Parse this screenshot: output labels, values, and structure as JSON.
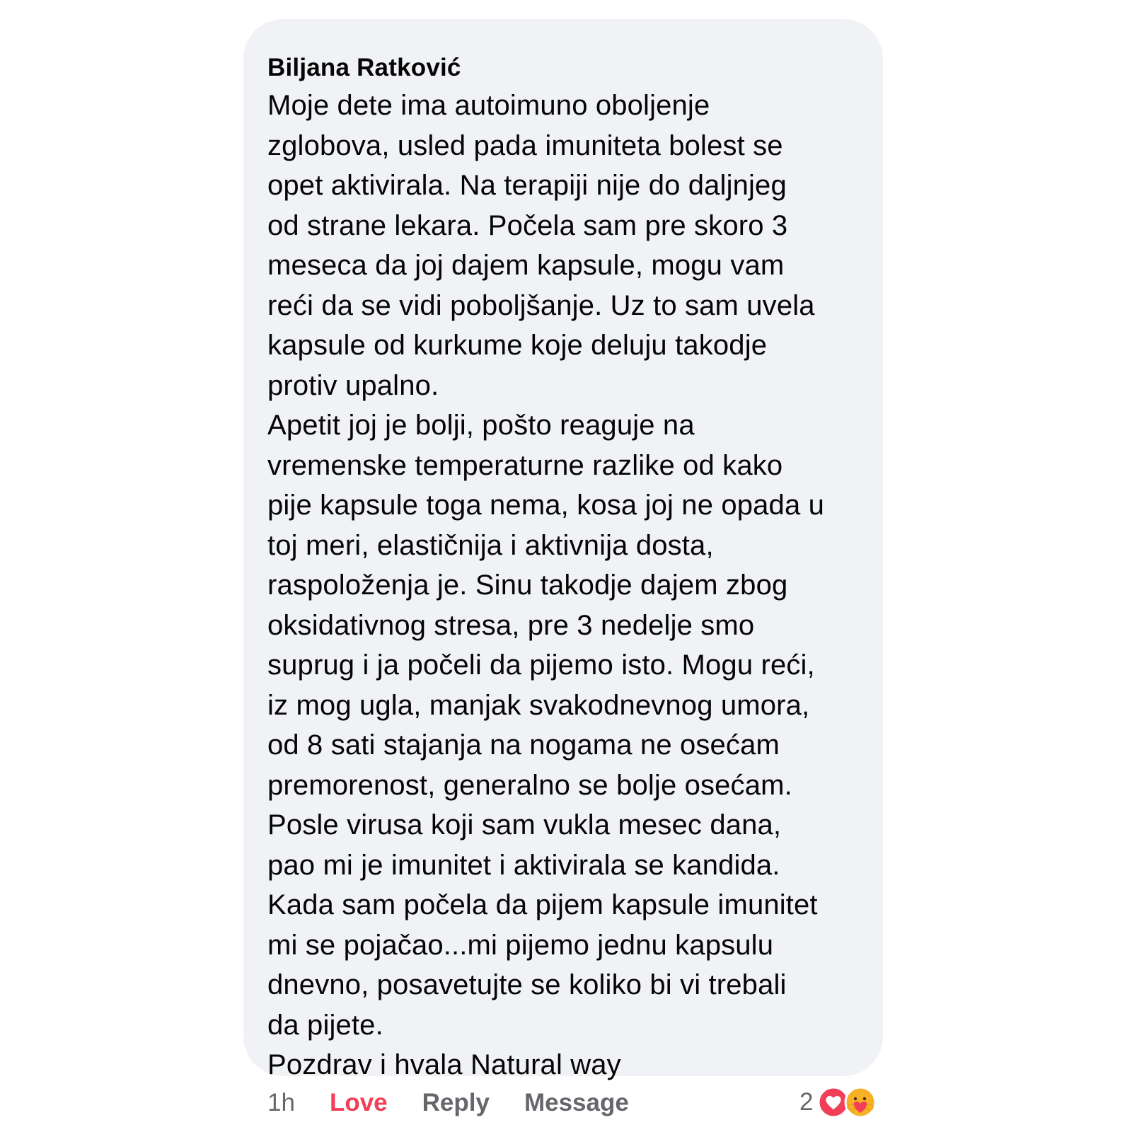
{
  "comment": {
    "author": "Biljana Ratković",
    "lines": [
      "Moje dete ima autoimuno oboljenje",
      "zglobova, usled pada imuniteta bolest se",
      "opet aktivirala. Na terapiji nije do daljnjeg",
      "od strane lekara. Počela sam pre skoro 3",
      "meseca da joj dajem kapsule, mogu vam",
      "reći da se vidi poboljšanje. Uz to sam uvela",
      "kapsule od kurkume koje deluju takodje",
      "protiv upalno.",
      "Apetit joj je bolji, pošto reaguje na",
      "vremenske temperaturne razlike od kako",
      "pije kapsule toga nema, kosa joj ne opada u",
      "toj meri, elastičnija i aktivnija dosta,",
      "raspoloženja je. Sinu takodje dajem zbog",
      "oksidativnog stresa, pre 3 nedelje smo",
      "suprug i ja počeli da pijemo isto. Mogu reći,",
      "iz mog ugla, manjak svakodnevnog umora,",
      "od 8 sati stajanja na nogama ne osećam",
      "premorenost, generalno se bolje osećam.",
      "Posle virusa koji sam vukla mesec dana,",
      "pao mi je imunitet i aktivirala se kandida.",
      "Kada sam počela da pijem kapsule imunitet",
      "mi se pojačao...mi pijemo jednu kapsulu",
      "dnevno, posavetujte se koliko bi vi trebali",
      "da pijete.",
      "Pozdrav i hvala Natural way"
    ]
  },
  "actions": {
    "time": "1h",
    "love": "Love",
    "reply": "Reply",
    "message": "Message"
  },
  "reactions": {
    "count": "2",
    "icons": [
      "love-reaction-icon",
      "care-reaction-icon"
    ]
  },
  "colors": {
    "bubble": "#f0f2f5",
    "love": "#f33e58",
    "muted": "#65676b"
  }
}
